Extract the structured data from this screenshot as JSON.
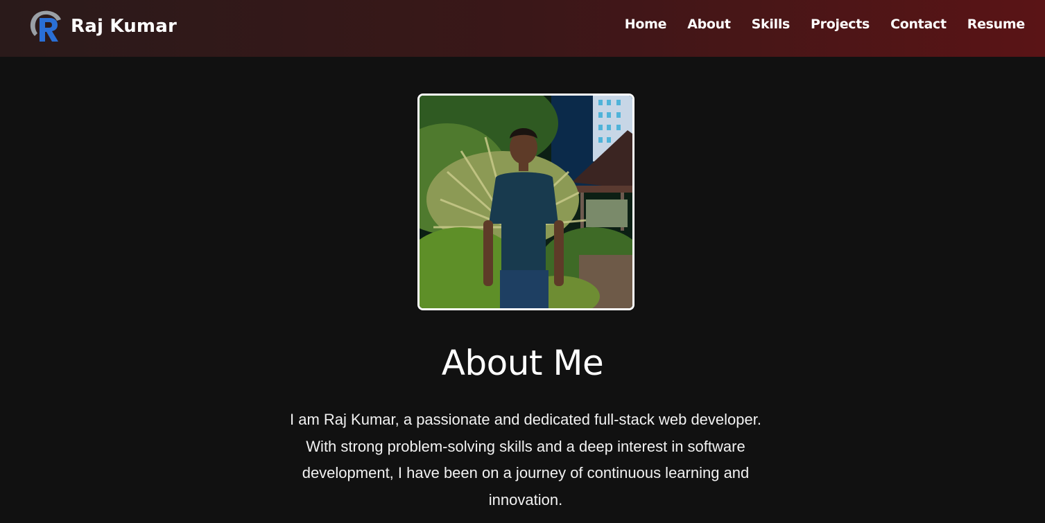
{
  "brand": {
    "name": "Raj Kumar",
    "logo_icon": "r-logo-icon"
  },
  "nav": {
    "items": [
      {
        "label": "Home"
      },
      {
        "label": "About"
      },
      {
        "label": "Skills"
      },
      {
        "label": "Projects"
      },
      {
        "label": "Contact"
      },
      {
        "label": "Resume"
      }
    ]
  },
  "about": {
    "title": "About Me",
    "description": "I am Raj Kumar, a passionate and dedicated full-stack web developer. With strong problem-solving skills and a deep interest in software development, I have been on a journey of continuous learning and innovation."
  },
  "colors": {
    "background": "#111111",
    "navbar_gradient_start": "#2a1a1a",
    "navbar_gradient_end": "#5a1416",
    "logo_blue": "#2a6fd6",
    "text": "#ffffff"
  }
}
